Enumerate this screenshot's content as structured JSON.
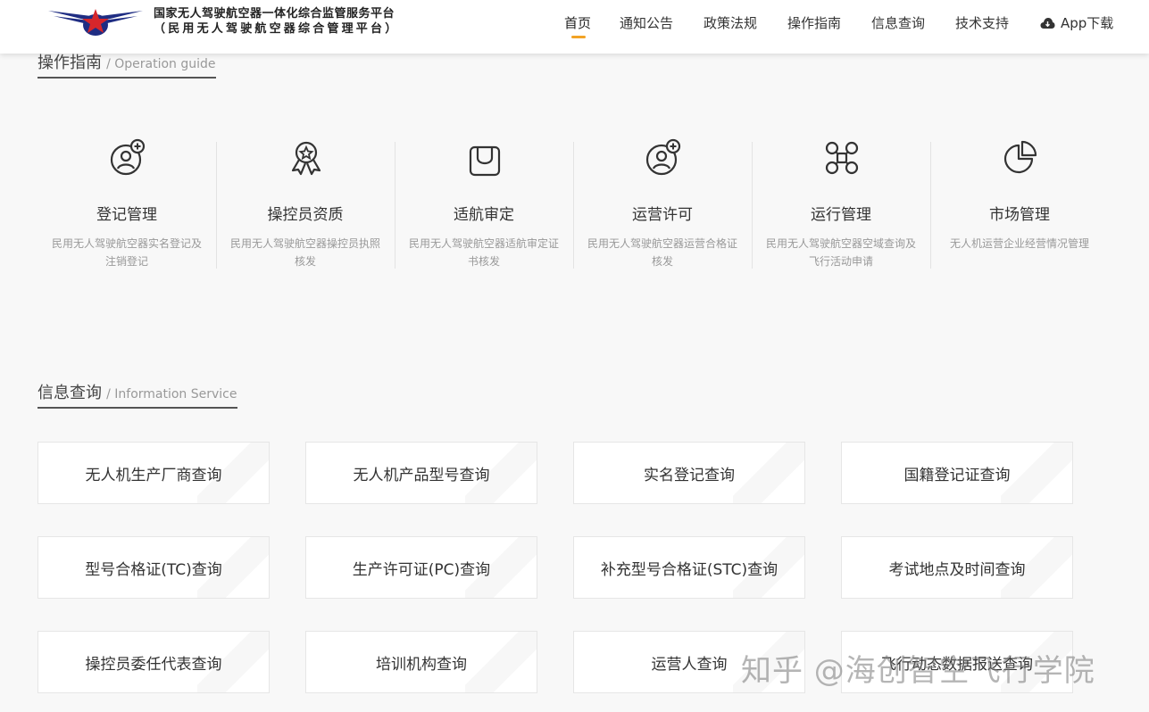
{
  "header": {
    "brand_line1": "国家无人驾驶航空器一体化综合监管服务平台",
    "brand_line2": "（民用无人驾驶航空器综合管理平台）",
    "nav": [
      {
        "label": "首页",
        "active": true
      },
      {
        "label": "通知公告"
      },
      {
        "label": "政策法规"
      },
      {
        "label": "操作指南"
      },
      {
        "label": "信息查询"
      },
      {
        "label": "技术支持"
      }
    ],
    "app_download": "App下载",
    "accent_color": "#f2a325"
  },
  "guide_section": {
    "title_zh": "操作指南",
    "title_en": "/ Operation guide",
    "items": [
      {
        "icon": "user-add-icon",
        "title": "登记管理",
        "desc": "民用无人驾驶航空器实名登记及注销登记"
      },
      {
        "icon": "award-medal-icon",
        "title": "操控员资质",
        "desc": "民用无人驾驶航空器操控员执照核发"
      },
      {
        "icon": "bag-icon",
        "title": "适航审定",
        "desc": "民用无人驾驶航空器适航审定证书核发"
      },
      {
        "icon": "user-add-icon",
        "title": "运营许可",
        "desc": "民用无人驾驶航空器运营合格证核发"
      },
      {
        "icon": "drone-icon",
        "title": "运行管理",
        "desc": "民用无人驾驶航空器空域查询及飞行活动申请"
      },
      {
        "icon": "pie-chart-icon",
        "title": "市场管理",
        "desc": "无人机运营企业经营情况管理"
      }
    ]
  },
  "info_section": {
    "title_zh": "信息查询",
    "title_en": "/ Information Service",
    "items": [
      "无人机生产厂商查询",
      "无人机产品型号查询",
      "实名登记查询",
      "国籍登记证查询",
      "型号合格证(TC)查询",
      "生产许可证(PC)查询",
      "补充型号合格证(STC)查询",
      "考试地点及时间查询",
      "操控员委任代表查询",
      "培训机构查询",
      "运营人查询",
      "飞行动态数据报送查询"
    ]
  },
  "watermark": "知乎 @海创智空飞行学院"
}
